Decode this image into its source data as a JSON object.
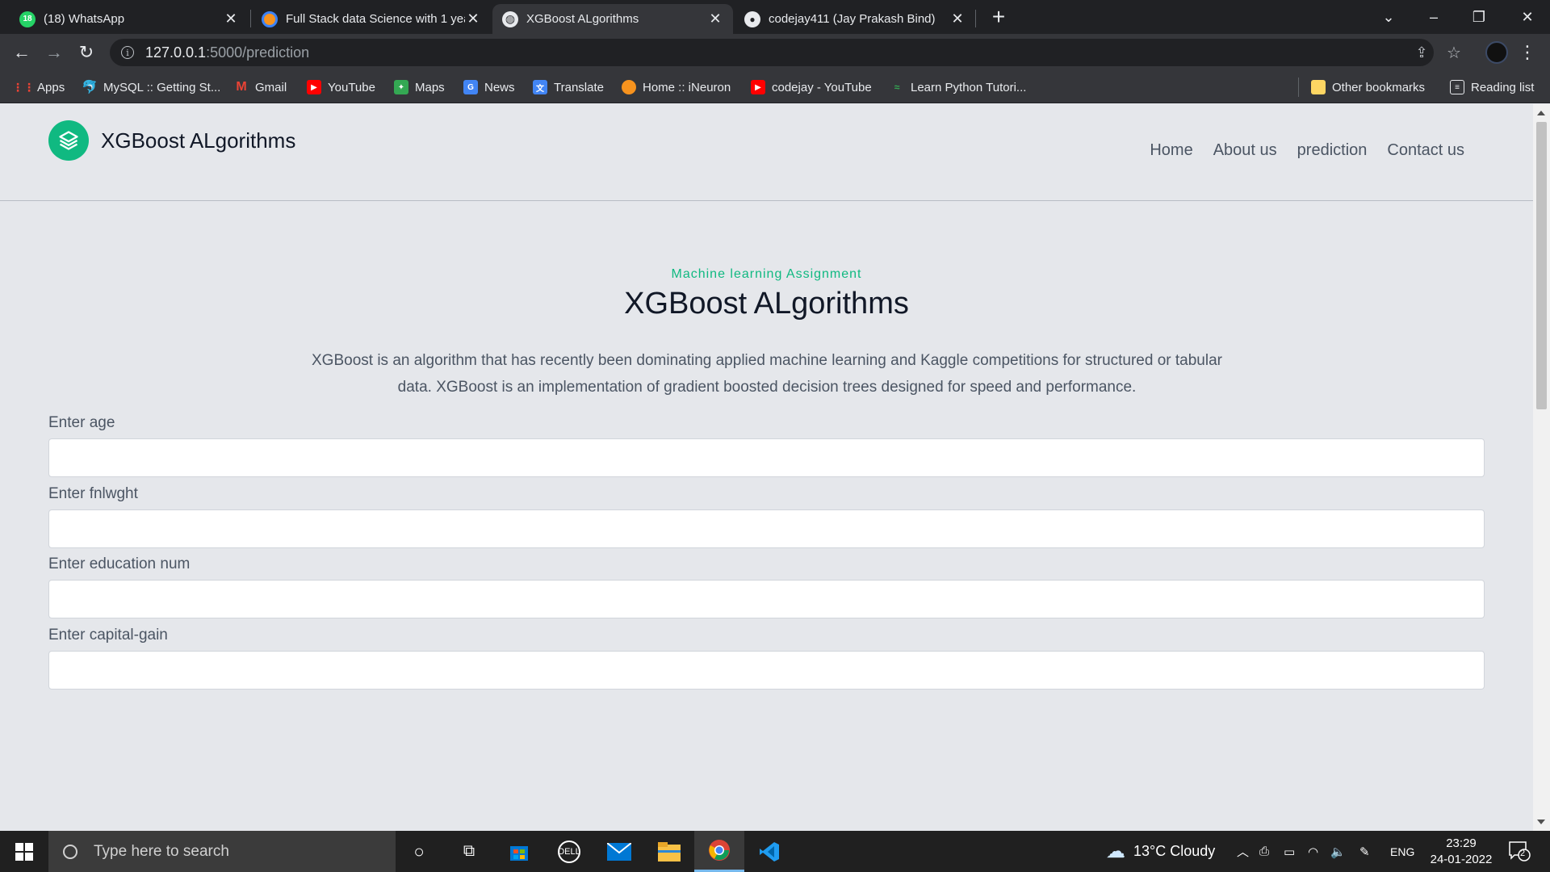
{
  "browser": {
    "tabs": [
      {
        "title": "(18) WhatsApp",
        "favicon": "whatsapp-icon"
      },
      {
        "title": "Full Stack data Science with 1 yea",
        "favicon": "ineuron-icon"
      },
      {
        "title": "XGBoost ALgorithms",
        "favicon": "globe-icon"
      },
      {
        "title": "codejay411 (Jay Prakash Bind)",
        "favicon": "github-icon"
      }
    ],
    "whatsapp_badge": "18",
    "url_host": "127.0.0.1",
    "url_path": ":5000/prediction",
    "bookmarks": [
      {
        "label": "Apps",
        "icon": "apps-grid-icon"
      },
      {
        "label": "MySQL :: Getting St...",
        "icon": "mysql-icon"
      },
      {
        "label": "Gmail",
        "icon": "gmail-icon"
      },
      {
        "label": "YouTube",
        "icon": "youtube-icon"
      },
      {
        "label": "Maps",
        "icon": "maps-icon"
      },
      {
        "label": "News",
        "icon": "news-icon"
      },
      {
        "label": "Translate",
        "icon": "translate-icon"
      },
      {
        "label": "Home :: iNeuron",
        "icon": "ineuron-icon"
      },
      {
        "label": "codejay - YouTube",
        "icon": "youtube-icon"
      },
      {
        "label": "Learn Python Tutori...",
        "icon": "python-icon"
      }
    ],
    "other_bookmarks": "Other bookmarks",
    "reading_list": "Reading list"
  },
  "site": {
    "brand": "XGBoost ALgorithms",
    "nav": [
      "Home",
      "About us",
      "prediction",
      "Contact us"
    ],
    "eyebrow": "Machine learning Assignment",
    "title": "XGBoost ALgorithms",
    "description": "XGBoost is an algorithm that has recently been dominating applied machine learning and Kaggle competitions for structured or tabular data. XGBoost is an implementation of gradient boosted decision trees designed for speed and performance.",
    "fields": [
      {
        "label": "Enter age",
        "value": ""
      },
      {
        "label": "Enter fnlwght",
        "value": ""
      },
      {
        "label": "Enter education num",
        "value": ""
      },
      {
        "label": "Enter capital-gain",
        "value": ""
      }
    ]
  },
  "taskbar": {
    "search_placeholder": "Type here to search",
    "weather": "13°C  Cloudy",
    "language": "ENG",
    "time": "23:29",
    "date": "24-01-2022",
    "notification_count": "2"
  },
  "colors": {
    "accent": "#10b981",
    "page_bg": "#e5e7eb",
    "chrome_dark": "#202124",
    "chrome_toolbar": "#35363a"
  }
}
